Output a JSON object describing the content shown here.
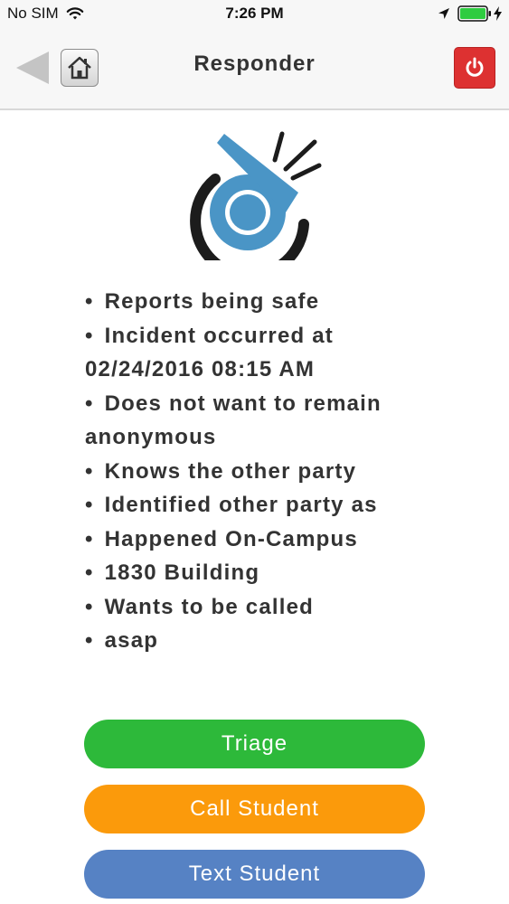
{
  "status_bar": {
    "carrier": "No SIM",
    "time": "7:26 PM",
    "icons": [
      "wifi-icon",
      "location-arrow-icon",
      "battery-icon",
      "charging-bolt-icon"
    ]
  },
  "nav": {
    "title": "Responder",
    "icons": [
      "back-arrow-icon",
      "home-icon",
      "power-icon"
    ],
    "power_color": "#dd3131"
  },
  "logo": {
    "icon": "whistle-logo-icon",
    "colors": {
      "primary": "#4a95c6",
      "dark": "#1c1c1c"
    }
  },
  "report_items": [
    "Reports being safe",
    "Incident occurred at",
    "02/24/2016 08:15 AM",
    "Does not want to remain",
    "anonymous",
    "Knows the other party",
    "Identified other party as",
    "Happened On-Campus",
    "1830 Building",
    "Wants to be called",
    "asap"
  ],
  "actions": {
    "triage": {
      "label": "Triage",
      "color": "#2db93a"
    },
    "call_student": {
      "label": "Call Student",
      "color": "#fb9a0b"
    },
    "text_student": {
      "label": "Text Student",
      "color": "#5682c4"
    }
  }
}
